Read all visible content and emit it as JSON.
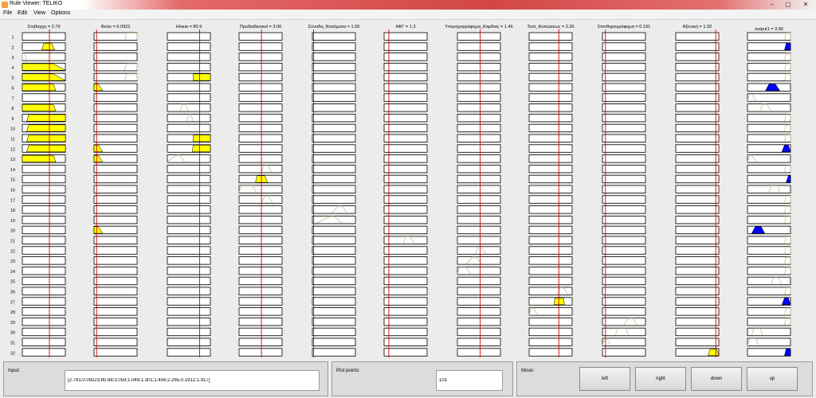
{
  "window": {
    "title": "Rule Viewer: TELIKO",
    "minimize_glyph": "‒",
    "maximize_glyph": "▢",
    "close_glyph": "✕"
  },
  "menu": [
    "File",
    "Edit",
    "View",
    "Options"
  ],
  "colors": {
    "input_fill": "#ffff00",
    "output_fill": "#0000ff",
    "indicator": "#d60000",
    "mf_line": "#c8c8a0",
    "cell_border": "#000000",
    "cell_bg": "#ffffff"
  },
  "rule_count": 32,
  "variables": [
    {
      "label": "Στηθαγχη = 2.79",
      "value": 2.791
    },
    {
      "label": "Φυλο = 0.0922",
      "value": 0.09223
    },
    {
      "label": "Ηλικια = 80.9",
      "value": 80.88
    },
    {
      "label": "Προδιαθεσικοί = 3.06",
      "value": 3.059
    },
    {
      "label": "Σύνοδα_Νοσήματα = 1.05",
      "value": 1.049
    },
    {
      "label": "ΗΚΓ = 1.3",
      "value": 1.301
    },
    {
      "label": "Υπερηχογράφημα_Καρδιας = 1.46",
      "value": 1.456
    },
    {
      "label": "Τεστ_Κοπώσεως = 2.26",
      "value": 2.265
    },
    {
      "label": "Σπινθηρογράφημα = 0.191",
      "value": 0.1912
    },
    {
      "label": "Αξονική = 1.92",
      "value": 1.917
    },
    {
      "label": "output1 = 3.96",
      "value": 3.96
    }
  ],
  "input_panel": {
    "label": "Input:",
    "value": "[2.791;0.09223;80.88;3.059;1.049;1.301;1.456;2.265;0.1912;1.917]"
  },
  "plot_points_panel": {
    "label": "Plot points:",
    "value": "101"
  },
  "move_panel": {
    "label": "Move:",
    "buttons": [
      "left",
      "right",
      "down",
      "up"
    ]
  }
}
